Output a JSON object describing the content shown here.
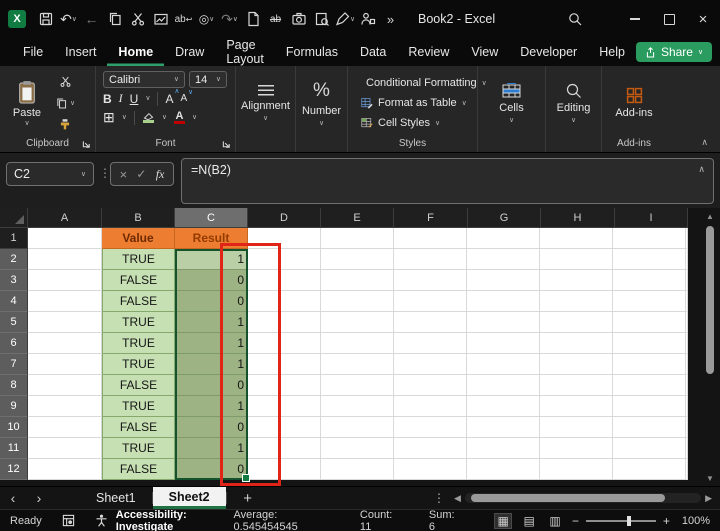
{
  "titlebar": {
    "title": "Book2 - Excel",
    "qat_icons": [
      "save",
      "undo",
      "back",
      "copy",
      "cut",
      "picture",
      "find-replace",
      "touch-mode",
      "redo",
      "new-file",
      "strikethrough",
      "camera",
      "print-preview",
      "ink",
      "permissions",
      "overflow"
    ],
    "overflow": "»"
  },
  "tabs": {
    "items": [
      "File",
      "Insert",
      "Home",
      "Draw",
      "Page Layout",
      "Formulas",
      "Data",
      "Review",
      "View",
      "Developer",
      "Help"
    ],
    "active": "Home",
    "share_label": "Share"
  },
  "ribbon": {
    "paste_label": "Paste",
    "clipboard_label": "Clipboard",
    "font_label": "Font",
    "font_name": "Calibri",
    "font_size": "14",
    "bold": "B",
    "italic": "I",
    "underline": "U",
    "grow_font": "A",
    "shrink_font": "A",
    "borders_glyph": "⊞",
    "font_color_letter": "A",
    "alignment_label": "Alignment",
    "number_label": "Number",
    "percent_glyph": "%",
    "styles": {
      "conditional": "Conditional Formatting",
      "format_table": "Format as Table",
      "cell_styles": "Cell Styles",
      "label": "Styles"
    },
    "cells_label": "Cells",
    "editing_label": "Editing",
    "addins_label": "Add-ins",
    "addins_group_label": "Add-ins"
  },
  "formula_bar": {
    "name_box": "C2",
    "cancel_glyph": "×",
    "enter_glyph": "✓",
    "fx_label": "fx",
    "formula": "=N(B2)"
  },
  "grid": {
    "columns": [
      "A",
      "B",
      "C",
      "D",
      "E",
      "F",
      "G",
      "H",
      "I"
    ],
    "selected_column": "C",
    "row_numbers": [
      "1",
      "2",
      "3",
      "4",
      "5",
      "6",
      "7",
      "8",
      "9",
      "10",
      "11",
      "12"
    ],
    "header_value": "Value",
    "header_result": "Result",
    "rows": [
      {
        "value": "TRUE",
        "result": "1"
      },
      {
        "value": "FALSE",
        "result": "0"
      },
      {
        "value": "FALSE",
        "result": "0"
      },
      {
        "value": "TRUE",
        "result": "1"
      },
      {
        "value": "TRUE",
        "result": "1"
      },
      {
        "value": "TRUE",
        "result": "1"
      },
      {
        "value": "FALSE",
        "result": "0"
      },
      {
        "value": "TRUE",
        "result": "1"
      },
      {
        "value": "FALSE",
        "result": "0"
      },
      {
        "value": "TRUE",
        "result": "1"
      },
      {
        "value": "FALSE",
        "result": "0"
      }
    ]
  },
  "sheet_bar": {
    "sheet1": "Sheet1",
    "sheet2": "Sheet2",
    "active": "Sheet2",
    "add_glyph": "+"
  },
  "status_bar": {
    "ready": "Ready",
    "accessibility": "Accessibility: Investigate",
    "average": "Average: 0.545454545",
    "count": "Count: 11",
    "sum": "Sum: 6",
    "zoom": "100%"
  },
  "colors": {
    "accent_green": "#217346",
    "tab_underline_green": "#2fa06b",
    "share_button_green": "#2a9c5f",
    "header_orange": "#ED7D31",
    "value_cell_green": "#C6E0B4",
    "result_cell_selected_green": "#9DB383",
    "active_cell_green": "#BACFA6",
    "selection_border_green": "#14532d",
    "annotation_red": "#e02417",
    "addins_icon_orange": "#c55a11"
  }
}
